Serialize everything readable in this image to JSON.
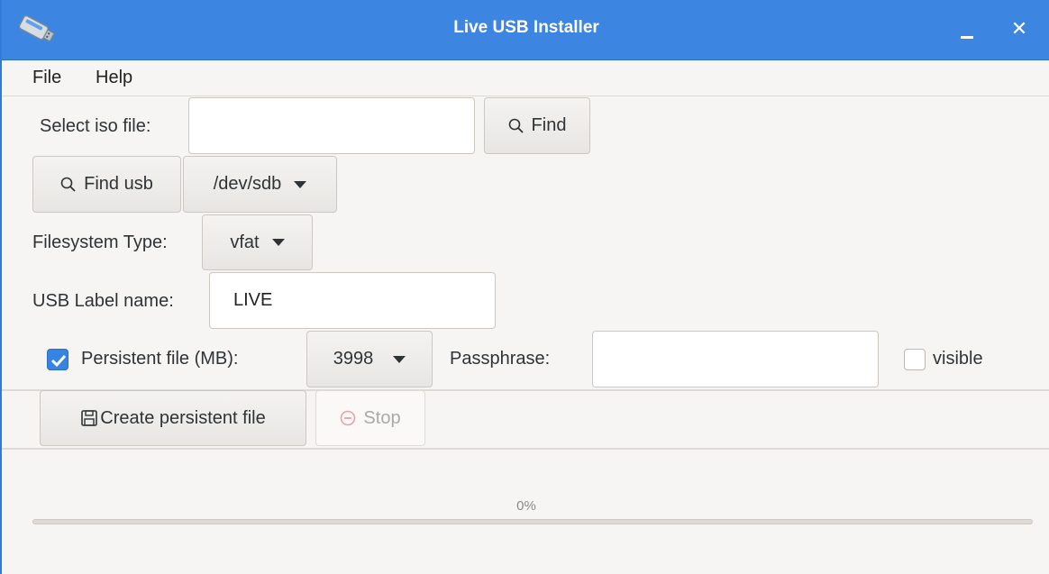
{
  "window": {
    "title": "Live USB Installer",
    "minimize_label": "–",
    "close_label": "✕"
  },
  "menubar": {
    "items": [
      "File",
      "Help"
    ]
  },
  "iso": {
    "label": "Select iso file:",
    "value": "",
    "find_label": "Find"
  },
  "usb": {
    "find_label": "Find usb",
    "device_value": "/dev/sdb"
  },
  "filesystem": {
    "label": "Filesystem Type:",
    "value": "vfat"
  },
  "usb_label": {
    "label": "USB Label name:",
    "value": "LIVE"
  },
  "persistent": {
    "checked": true,
    "label": "Persistent file (MB):",
    "size_value": "3998",
    "passphrase_label": "Passphrase:",
    "passphrase_value": "",
    "visible_label": "visible",
    "visible_checked": false
  },
  "actions": {
    "create_label": "Create persistent file",
    "stop_label": "Stop",
    "stop_enabled": false
  },
  "progress": {
    "text": "0%",
    "fraction": 0
  },
  "colors": {
    "titlebar": "#3c85e1",
    "accent": "#3584e4",
    "stop_icon": "#e8a0a8"
  }
}
